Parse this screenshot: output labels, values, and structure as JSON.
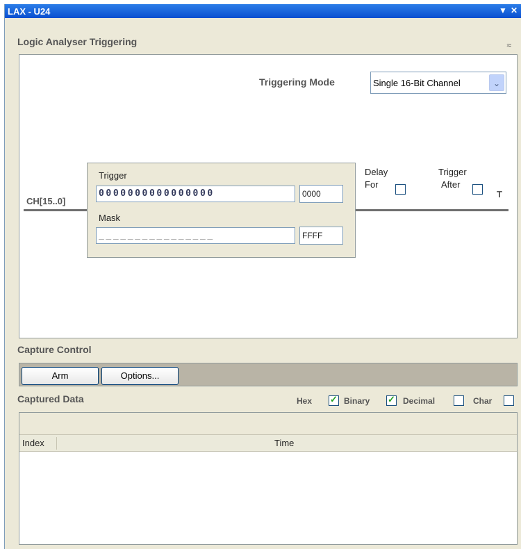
{
  "window": {
    "title": "LAX - U24",
    "dropdown_glyph": "▼",
    "close_glyph": "✕"
  },
  "triggering": {
    "section_title": "Logic Analyser Triggering",
    "collapse_glyph": "≈",
    "mode_label": "Triggering Mode",
    "mode_value": "Single 16-Bit Channel",
    "mode_arrow": "⌄",
    "channel_label": "CH[15..0]",
    "trigger_label": "Trigger",
    "trigger_bits": "0000000000000000",
    "trigger_hex": "0000",
    "mask_label": "Mask",
    "mask_bits": "________________",
    "mask_hex": "FFFF",
    "delay_label_1": "Delay",
    "delay_label_2": "For",
    "delay_checked": false,
    "trigger_after_1": "Trigger",
    "trigger_after_2": "After",
    "trigger_after_checked": false,
    "t_label": "T"
  },
  "capture": {
    "section_title": "Capture Control",
    "arm_label": "Arm",
    "options_label": "Options..."
  },
  "captured": {
    "section_title": "Captured Data",
    "formats": [
      {
        "label": "Hex",
        "checked": true
      },
      {
        "label": "Binary",
        "checked": true
      },
      {
        "label": "Decimal",
        "checked": false
      },
      {
        "label": "Char",
        "checked": false
      }
    ],
    "columns": [
      "Index",
      "Time"
    ]
  },
  "colors": {
    "title_bar": "#0a4fd0",
    "panel_bg": "#ece9d8",
    "section_text": "#555555"
  }
}
